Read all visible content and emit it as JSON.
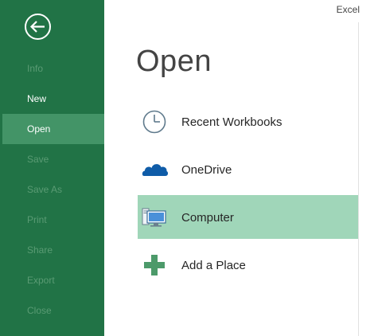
{
  "window": {
    "app_name": "Excel"
  },
  "sidebar": {
    "back_icon": "back-arrow-icon",
    "items": [
      {
        "label": "Info",
        "state": "disabled"
      },
      {
        "label": "New",
        "state": "enabled"
      },
      {
        "label": "Open",
        "state": "active"
      },
      {
        "label": "Save",
        "state": "disabled"
      },
      {
        "label": "Save As",
        "state": "disabled"
      },
      {
        "label": "Print",
        "state": "disabled"
      },
      {
        "label": "Share",
        "state": "disabled"
      },
      {
        "label": "Export",
        "state": "disabled"
      },
      {
        "label": "Close",
        "state": "disabled"
      }
    ]
  },
  "main": {
    "title": "Open",
    "places": [
      {
        "label": "Recent Workbooks",
        "icon": "clock-icon",
        "selected": false
      },
      {
        "label": "OneDrive",
        "icon": "cloud-icon",
        "selected": false
      },
      {
        "label": "Computer",
        "icon": "computer-icon",
        "selected": true
      },
      {
        "label": "Add a Place",
        "icon": "plus-icon",
        "selected": false
      }
    ]
  },
  "colors": {
    "sidebar": "#217346",
    "sidebar_active": "#439467",
    "sidebar_disabled_text": "#5a9b74",
    "selected_place": "#a0d6b9",
    "onedrive_blue": "#0f5ca8",
    "accent_green": "#217346"
  }
}
